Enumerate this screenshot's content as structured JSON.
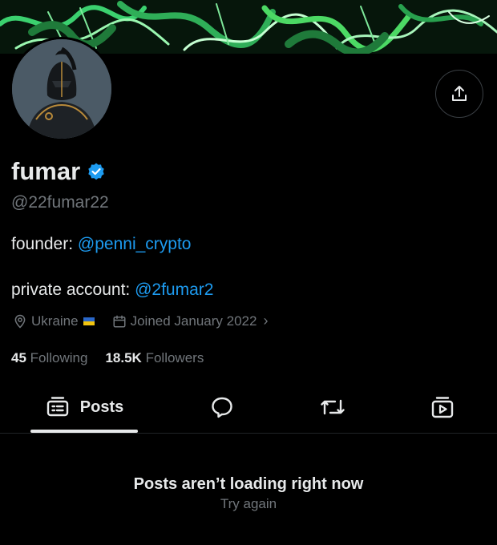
{
  "profile": {
    "display_name": "fumar",
    "handle": "@22fumar22",
    "bio": {
      "line1_prefix": "founder: ",
      "line1_mention": "@penni_crypto",
      "line2_prefix": "private account: ",
      "line2_mention": "@2fumar2"
    },
    "location": "Ukraine",
    "joined": "Joined January 2022",
    "following_count": "45",
    "following_label": "Following",
    "followers_count": "18.5K",
    "followers_label": "Followers"
  },
  "tabs": {
    "posts_label": "Posts"
  },
  "empty_state": {
    "title": "Posts aren’t loading right now",
    "retry": "Try again"
  },
  "colors": {
    "background": "#000000",
    "text": "#e7e9ea",
    "muted": "#71767b",
    "accent": "#1d9bf0",
    "banner_green": "#4cd964"
  },
  "icons": {
    "share": "share-icon",
    "verified": "verified-badge-icon",
    "location": "location-pin-icon",
    "calendar": "calendar-icon",
    "posts_tab": "posts-icon",
    "replies_tab": "reply-bubble-icon",
    "reposts_tab": "repost-icon",
    "media_tab": "media-play-icon"
  }
}
